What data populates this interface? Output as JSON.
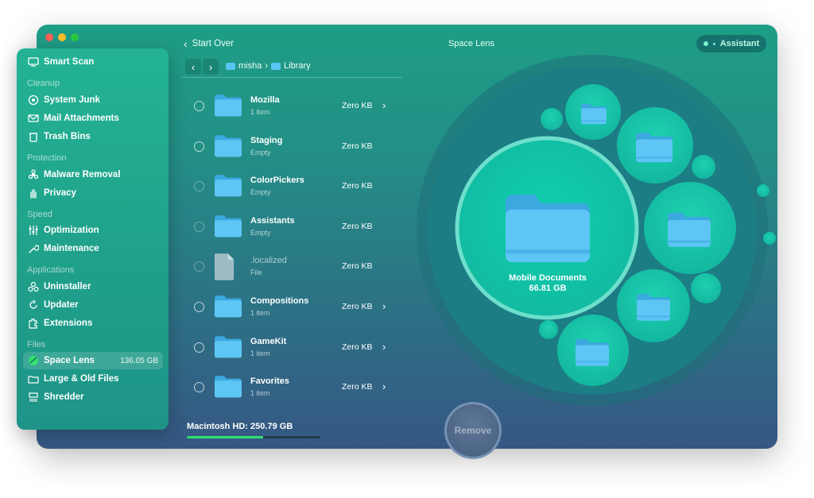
{
  "window": {
    "title": "Space Lens"
  },
  "topbar": {
    "start_over": "Start Over",
    "assistant": "Assistant"
  },
  "breadcrumb": [
    "misha",
    "Library"
  ],
  "sidebar": {
    "smart_scan": "Smart Scan",
    "sections": [
      {
        "title": "Cleanup",
        "items": [
          "System Junk",
          "Mail Attachments",
          "Trash Bins"
        ]
      },
      {
        "title": "Protection",
        "items": [
          "Malware Removal",
          "Privacy"
        ]
      },
      {
        "title": "Speed",
        "items": [
          "Optimization",
          "Maintenance"
        ]
      },
      {
        "title": "Applications",
        "items": [
          "Uninstaller",
          "Updater",
          "Extensions"
        ]
      },
      {
        "title": "Files",
        "items": [
          "Space Lens",
          "Large & Old Files",
          "Shredder"
        ]
      }
    ],
    "active_item": "Space Lens",
    "active_size": "136.05 GB"
  },
  "files": [
    {
      "name": "Mozilla",
      "sub": "1 item",
      "size": "Zero KB",
      "type": "folder",
      "chevron": true
    },
    {
      "name": "Staging",
      "sub": "Empty",
      "size": "Zero KB",
      "type": "folder",
      "chevron": false
    },
    {
      "name": "ColorPickers",
      "sub": "Empty",
      "size": "Zero KB",
      "type": "folder",
      "chevron": false
    },
    {
      "name": "Assistants",
      "sub": "Empty",
      "size": "Zero KB",
      "type": "folder",
      "chevron": false
    },
    {
      "name": ".localized",
      "sub": "File",
      "size": "Zero KB",
      "type": "file",
      "chevron": false
    },
    {
      "name": "Compositions",
      "sub": "1 item",
      "size": "Zero KB",
      "type": "folder",
      "chevron": true
    },
    {
      "name": "GameKit",
      "sub": "1 item",
      "size": "Zero KB",
      "type": "folder",
      "chevron": true
    },
    {
      "name": "Favorites",
      "sub": "1 item",
      "size": "Zero KB",
      "type": "folder",
      "chevron": true
    }
  ],
  "disk": {
    "label": "Macintosh HD: 250.79 GB",
    "used_fraction": 0.57
  },
  "bubble": {
    "name": "Mobile Documents",
    "size": "66.81 GB"
  },
  "actions": {
    "remove": "Remove"
  },
  "colors": {
    "accent": "#23b394",
    "folder": "#57c6f2",
    "disk_fill": "#2ee06f"
  }
}
